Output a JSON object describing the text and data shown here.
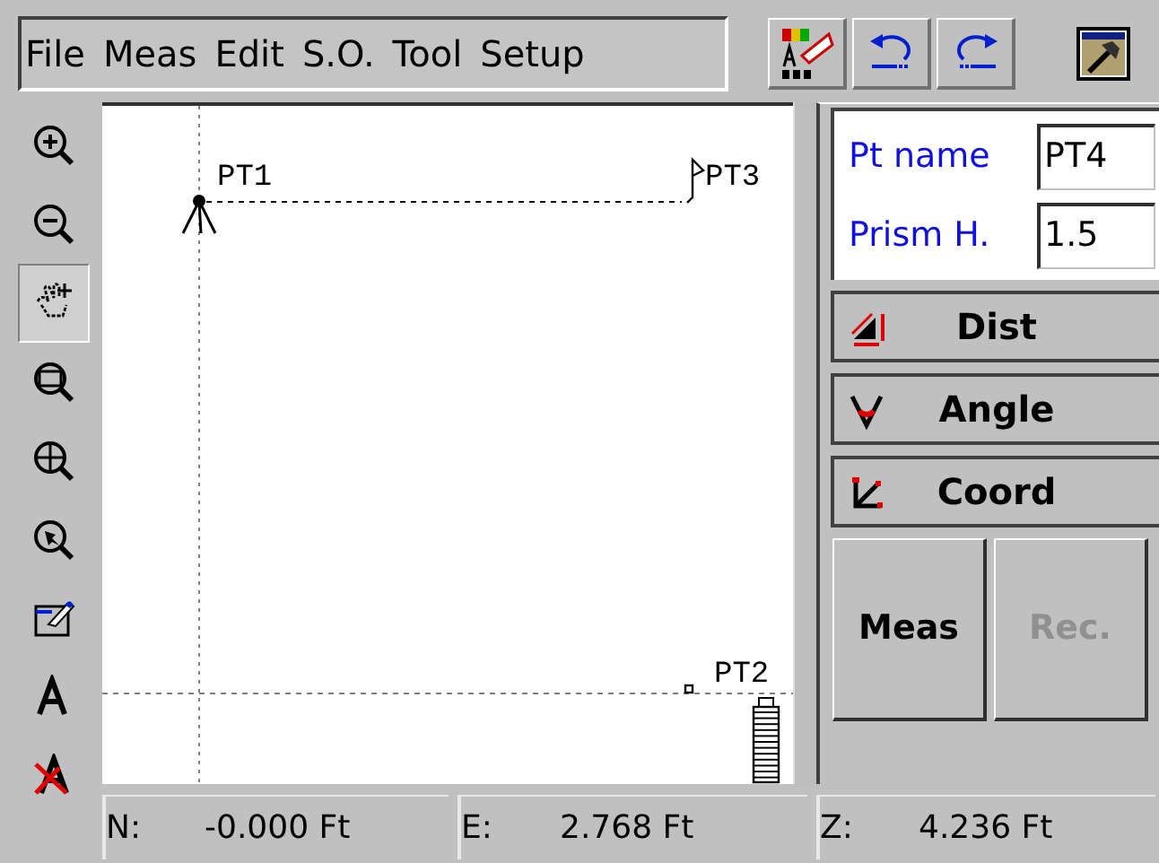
{
  "menu": [
    "File",
    "Meas",
    "Edit",
    "S.O.",
    "Tool",
    "Setup"
  ],
  "toolbar": [
    {
      "kind": "palette"
    },
    {
      "kind": "undo"
    },
    {
      "kind": "redo"
    },
    {
      "kind": "tools"
    }
  ],
  "side_tools": [
    {
      "kind": "zoom-in",
      "selected": false
    },
    {
      "kind": "zoom-out",
      "selected": false
    },
    {
      "kind": "pan",
      "selected": true
    },
    {
      "kind": "zoom-window",
      "selected": false
    },
    {
      "kind": "zoom-extents",
      "selected": false
    },
    {
      "kind": "zoom-previous",
      "selected": false
    },
    {
      "kind": "edit",
      "selected": false
    },
    {
      "kind": "text",
      "selected": false
    },
    {
      "kind": "text-off",
      "selected": false
    }
  ],
  "points": [
    {
      "label": "PT1",
      "kind": "instrument"
    },
    {
      "label": "PT3",
      "kind": "flag"
    },
    {
      "label": "PT2",
      "kind": "point"
    }
  ],
  "fields": [
    {
      "label": "Pt name",
      "value": "PT4"
    },
    {
      "label": "Prism H.",
      "value": "1.5"
    }
  ],
  "modes": [
    {
      "label": "Dist",
      "kind": "dist"
    },
    {
      "label": "Angle",
      "kind": "angle"
    },
    {
      "label": "Coord",
      "kind": "coord"
    }
  ],
  "actions": [
    {
      "label": "Meas",
      "disabled": false
    },
    {
      "label": "Rec.",
      "disabled": true
    }
  ],
  "status_bar": [
    {
      "label": "N:",
      "value": "-0.000 Ft"
    },
    {
      "label": "E:",
      "value": "2.768 Ft"
    },
    {
      "label": "Z:",
      "value": "4.236 Ft"
    }
  ]
}
